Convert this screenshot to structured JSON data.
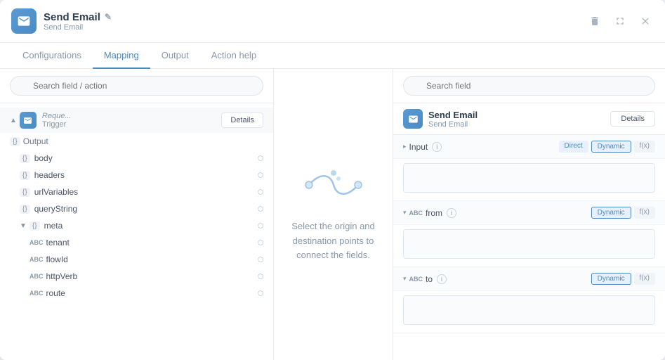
{
  "window": {
    "title": "Send Email",
    "subtitle": "Send Email",
    "edit_icon": "✎"
  },
  "title_actions": {
    "delete_label": "🗑",
    "expand_label": "⛶",
    "close_label": "✕"
  },
  "tabs": [
    {
      "id": "configurations",
      "label": "Configurations",
      "active": false
    },
    {
      "id": "mapping",
      "label": "Mapping",
      "active": true
    },
    {
      "id": "output",
      "label": "Output",
      "active": false
    },
    {
      "id": "action_help",
      "label": "Action help",
      "active": false
    }
  ],
  "left_panel": {
    "search_placeholder": "Search field / action",
    "trigger_label": "Trigger",
    "details_button": "Details",
    "tree": {
      "output_label": "Output",
      "items": [
        {
          "id": "body",
          "label": "body",
          "type": "{}",
          "indent": 1
        },
        {
          "id": "headers",
          "label": "headers",
          "type": "{}",
          "indent": 1
        },
        {
          "id": "urlVariables",
          "label": "urlVariables",
          "type": "{}",
          "indent": 1
        },
        {
          "id": "queryString",
          "label": "queryString",
          "type": "{}",
          "indent": 1
        },
        {
          "id": "meta",
          "label": "meta",
          "type": "{}",
          "indent": 1,
          "expanded": true
        },
        {
          "id": "tenant",
          "label": "tenant",
          "type": "ABC",
          "indent": 2
        },
        {
          "id": "flowId",
          "label": "flowId",
          "type": "ABC",
          "indent": 2
        },
        {
          "id": "httpVerb",
          "label": "httpVerb",
          "type": "ABC",
          "indent": 2
        },
        {
          "id": "route",
          "label": "route",
          "type": "ABC",
          "indent": 2
        }
      ]
    }
  },
  "middle_panel": {
    "connect_text": "Select the origin and destination points to connect the fields."
  },
  "right_panel": {
    "search_placeholder": "Search field",
    "destination": {
      "title": "Send Email",
      "subtitle": "Send Email",
      "details_button": "Details"
    },
    "fields": [
      {
        "id": "input",
        "label": "Input",
        "tags": [
          "Direct",
          "Dynamic",
          "f(x)"
        ],
        "collapsed": false
      },
      {
        "id": "from",
        "label": "from",
        "type": "ABC",
        "tags": [
          "Dynamic",
          "f(x)"
        ],
        "collapsed": false
      },
      {
        "id": "to",
        "label": "to",
        "type": "ABC",
        "tags": [
          "Dynamic",
          "f(x)"
        ],
        "collapsed": false
      }
    ]
  }
}
